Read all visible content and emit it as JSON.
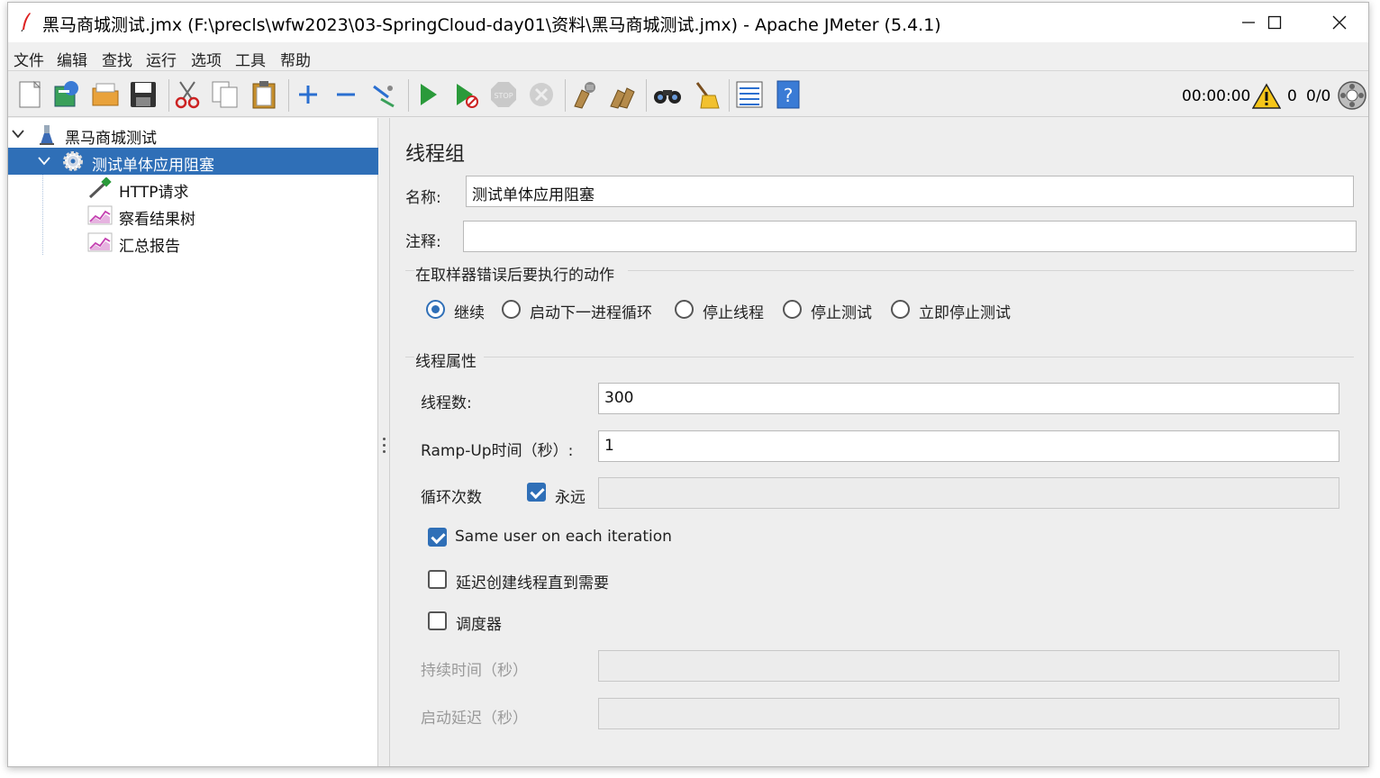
{
  "window": {
    "title": "黑马商城测试.jmx (F:\\precls\\wfw2023\\03-SpringCloud-day01\\资料\\黑马商城测试.jmx) - Apache JMeter (5.4.1)"
  },
  "menubar": {
    "items": [
      "文件",
      "编辑",
      "查找",
      "运行",
      "选项",
      "工具",
      "帮助"
    ]
  },
  "toolbar": {
    "buttons": [
      "new-icon",
      "templates-icon",
      "open-icon",
      "save-icon",
      "cut-icon",
      "copy-icon",
      "paste-icon",
      "expand-icon",
      "collapse-icon",
      "toggle-icon",
      "start-icon",
      "start-no-pauses-icon",
      "stop-icon",
      "shutdown-icon",
      "clear-icon",
      "clear-all-icon",
      "search-icon",
      "reset-search-icon",
      "function-helper-icon",
      "help-icon"
    ],
    "timer": "00:00:00",
    "warnings": "0",
    "threads": "0/0"
  },
  "tree": {
    "root": "黑马商城测试",
    "thread_group": "测试单体应用阻塞",
    "children": [
      "HTTP请求",
      "察看结果树",
      "汇总报告"
    ]
  },
  "panel": {
    "title": "线程组",
    "name_label": "名称:",
    "name_value": "测试单体应用阻塞",
    "comment_label": "注释:",
    "comment_value": "",
    "error_action_title": "在取样器错误后要执行的动作",
    "error_actions": [
      "继续",
      "启动下一进程循环",
      "停止线程",
      "停止测试",
      "立即停止测试"
    ],
    "error_action_selected": "继续",
    "thread_props_title": "线程属性",
    "threads_label": "线程数:",
    "threads_value": "300",
    "rampup_label": "Ramp-Up时间（秒）:",
    "rampup_value": "1",
    "loop_label": "循环次数",
    "forever_label": "永远",
    "forever_checked": true,
    "same_user_label": "Same user on each iteration",
    "same_user_checked": true,
    "delay_create_label": "延迟创建线程直到需要",
    "delay_create_checked": false,
    "scheduler_label": "调度器",
    "scheduler_checked": false,
    "duration_label": "持续时间（秒）",
    "startup_delay_label": "启动延迟（秒）"
  }
}
